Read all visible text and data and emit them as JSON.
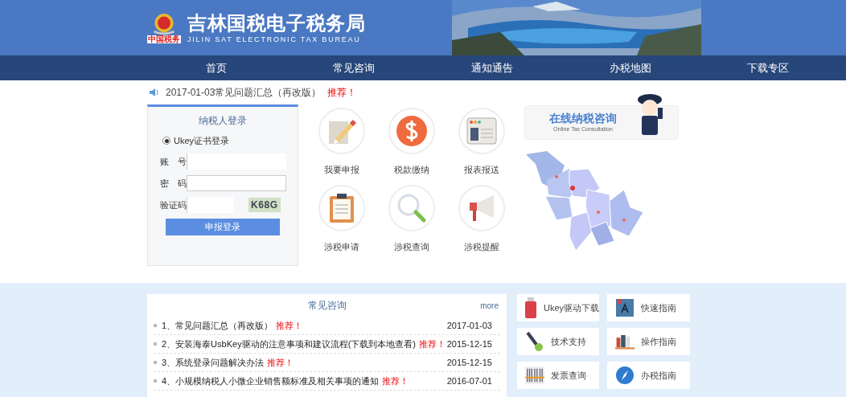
{
  "header": {
    "title": "吉林国税电子税务局",
    "subtitle": "JILIN SAT ELECTRONIC TAX BUREAU",
    "emblem_text": "中国税务"
  },
  "nav": [
    {
      "label": "首页"
    },
    {
      "label": "常见咨询"
    },
    {
      "label": "通知通告"
    },
    {
      "label": "办税地图"
    },
    {
      "label": "下载专区"
    }
  ],
  "notice": {
    "text": "2017-01-03常见问题汇总（再改版）",
    "tag": "推荐！"
  },
  "login": {
    "title": "纳税人登录",
    "options": [
      {
        "label": "Ukey证书登录",
        "selected": true
      }
    ],
    "fields": [
      {
        "kind": "text",
        "label": "账　号"
      },
      {
        "kind": "password",
        "label": "密　码"
      },
      {
        "kind": "captcha",
        "label": "验证码",
        "code": "K68G"
      }
    ],
    "button": "申报登录"
  },
  "services": [
    {
      "kind": "declare",
      "label": "我要申报"
    },
    {
      "kind": "pay",
      "label": "税款缴纳"
    },
    {
      "kind": "report",
      "label": "报表报送"
    },
    {
      "kind": "apply",
      "label": "涉税申请"
    },
    {
      "kind": "query",
      "label": "涉税查询"
    },
    {
      "kind": "remind",
      "label": "涉税提醒"
    }
  ],
  "consult": {
    "title": "在线纳税咨询",
    "subtitle": "Online Tax Consultation"
  },
  "faq": {
    "title": "常见咨询",
    "more": "more",
    "items": [
      {
        "text": "1、常见问题汇总（再改版）",
        "tag": "推荐！",
        "date": "2017-01-03"
      },
      {
        "text": "2、安装海泰UsbKey驱动的注意事项和建议流程(下载到本地查看)",
        "tag": "推荐！",
        "date": "2015-12-15"
      },
      {
        "text": "3、系统登录问题解决办法",
        "tag": "推荐！",
        "date": "2015-12-15"
      },
      {
        "text": "4、小规模纳税人小微企业销售额标准及相关事项的通知",
        "tag": "推荐！",
        "date": "2016-07-01"
      }
    ]
  },
  "tiles": [
    {
      "kind": "usb",
      "label": "Ukey驱动下载"
    },
    {
      "kind": "book",
      "label": "快速指南"
    },
    {
      "kind": "wrench",
      "label": "技术支持"
    },
    {
      "kind": "books",
      "label": "操作指南"
    },
    {
      "kind": "barcode",
      "label": "发票查询"
    },
    {
      "kind": "compass",
      "label": "办税指南"
    }
  ]
}
